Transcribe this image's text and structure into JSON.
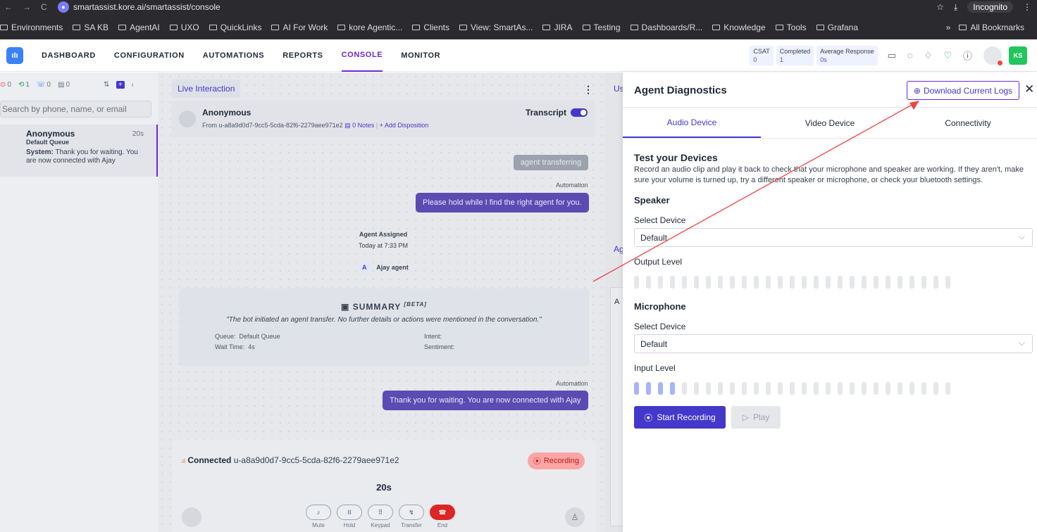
{
  "browser": {
    "url": "smartassist.kore.ai/smartassist/console",
    "incognito_label": "Incognito",
    "bookmarks": [
      "Environments",
      "SA KB",
      "AgentAI",
      "UXO",
      "QuickLinks",
      "AI For Work",
      "kore Agentic...",
      "Clients",
      "View: SmartAs...",
      "JIRA",
      "Testing",
      "Dashboards/R...",
      "Knowledge",
      "Tools",
      "Grafana"
    ],
    "all_bookmarks": "All Bookmarks"
  },
  "header": {
    "nav": [
      "DASHBOARD",
      "CONFIGURATION",
      "AUTOMATIONS",
      "REPORTS",
      "CONSOLE",
      "MONITOR"
    ],
    "active_nav": "CONSOLE",
    "metrics": [
      {
        "label": "CSAT",
        "value": "0"
      },
      {
        "label": "Completed",
        "value": "1"
      },
      {
        "label": "Average Response",
        "value": "0s"
      }
    ],
    "user_initials": "KS"
  },
  "left": {
    "counts": [
      "0",
      "1",
      "0",
      "0"
    ],
    "search_placeholder": "Search by phone, name, or email",
    "conversation": {
      "name": "Anonymous",
      "time": "20s",
      "queue": "Default Queue",
      "msg_prefix": "System:",
      "msg": "Thank you for waiting. You are now connected with Ajay"
    }
  },
  "middle": {
    "tab": "Live Interaction",
    "customer_name": "Anonymous",
    "from": "From u-a8a9d0d7-9cc5-5cda-82f6-2279aee971e2",
    "notes": "0 Notes",
    "add_disposition": "+ Add Disposition",
    "transcript": "Transcript",
    "gray_bubble": "agent transferring",
    "automation_label": "Automation",
    "hold_msg": "Please hold while I find the right agent for you.",
    "assigned_title": "Agent Assigned",
    "assigned_time": "Today at 7:33 PM",
    "agent_initial": "A",
    "agent_name": "Ajay agent",
    "summary_title": "SUMMARY",
    "summary_beta": "[BETA]",
    "summary_quote": "\"The bot initiated an agent transfer. No further details or actions were mentioned in the conversation.\"",
    "queue_label": "Queue:",
    "queue_value": "Default Queue",
    "wait_label": "Wait Time:",
    "wait_value": "4s",
    "intent_label": "Intent:",
    "sentiment_label": "Sentiment:",
    "connected_msg": "Thank you for waiting. You are now connected with Ajay",
    "call": {
      "status": "Connected",
      "id": "u-a8a9d0d7-9cc5-5cda-82f6-2279aee971e2",
      "recording": "Recording",
      "timer": "20s",
      "controls": [
        "Mute",
        "Hold",
        "Keypad",
        "Transfer",
        "End"
      ]
    }
  },
  "sliver": {
    "top": "Us",
    "mid": "Ag",
    "box": "A"
  },
  "drawer": {
    "title": "Agent Diagnostics",
    "download_btn": "Download Current Logs",
    "tabs": [
      "Audio Device",
      "Video Device",
      "Connectivity"
    ],
    "active_tab": "Audio Device",
    "test_title": "Test your Devices",
    "test_desc": "Record an audio clip and play it back to check that your microphone and speaker are working. If they aren't, make sure your volume is turned up, try a different speaker or microphone, or check your bluetooth settings.",
    "speaker_title": "Speaker",
    "select_device_label": "Select Device",
    "speaker_device": "Default",
    "output_level_label": "Output Level",
    "output_level_active": 0,
    "microphone_title": "Microphone",
    "mic_device": "Default",
    "input_level_label": "Input Level",
    "input_level_active": 4,
    "level_bar_count": 27,
    "start_recording": "Start Recording",
    "play": "Play"
  },
  "colors": {
    "accent": "#4338ca",
    "brand": "#6d28d9",
    "danger": "#dc2626",
    "success": "#22c55e"
  }
}
